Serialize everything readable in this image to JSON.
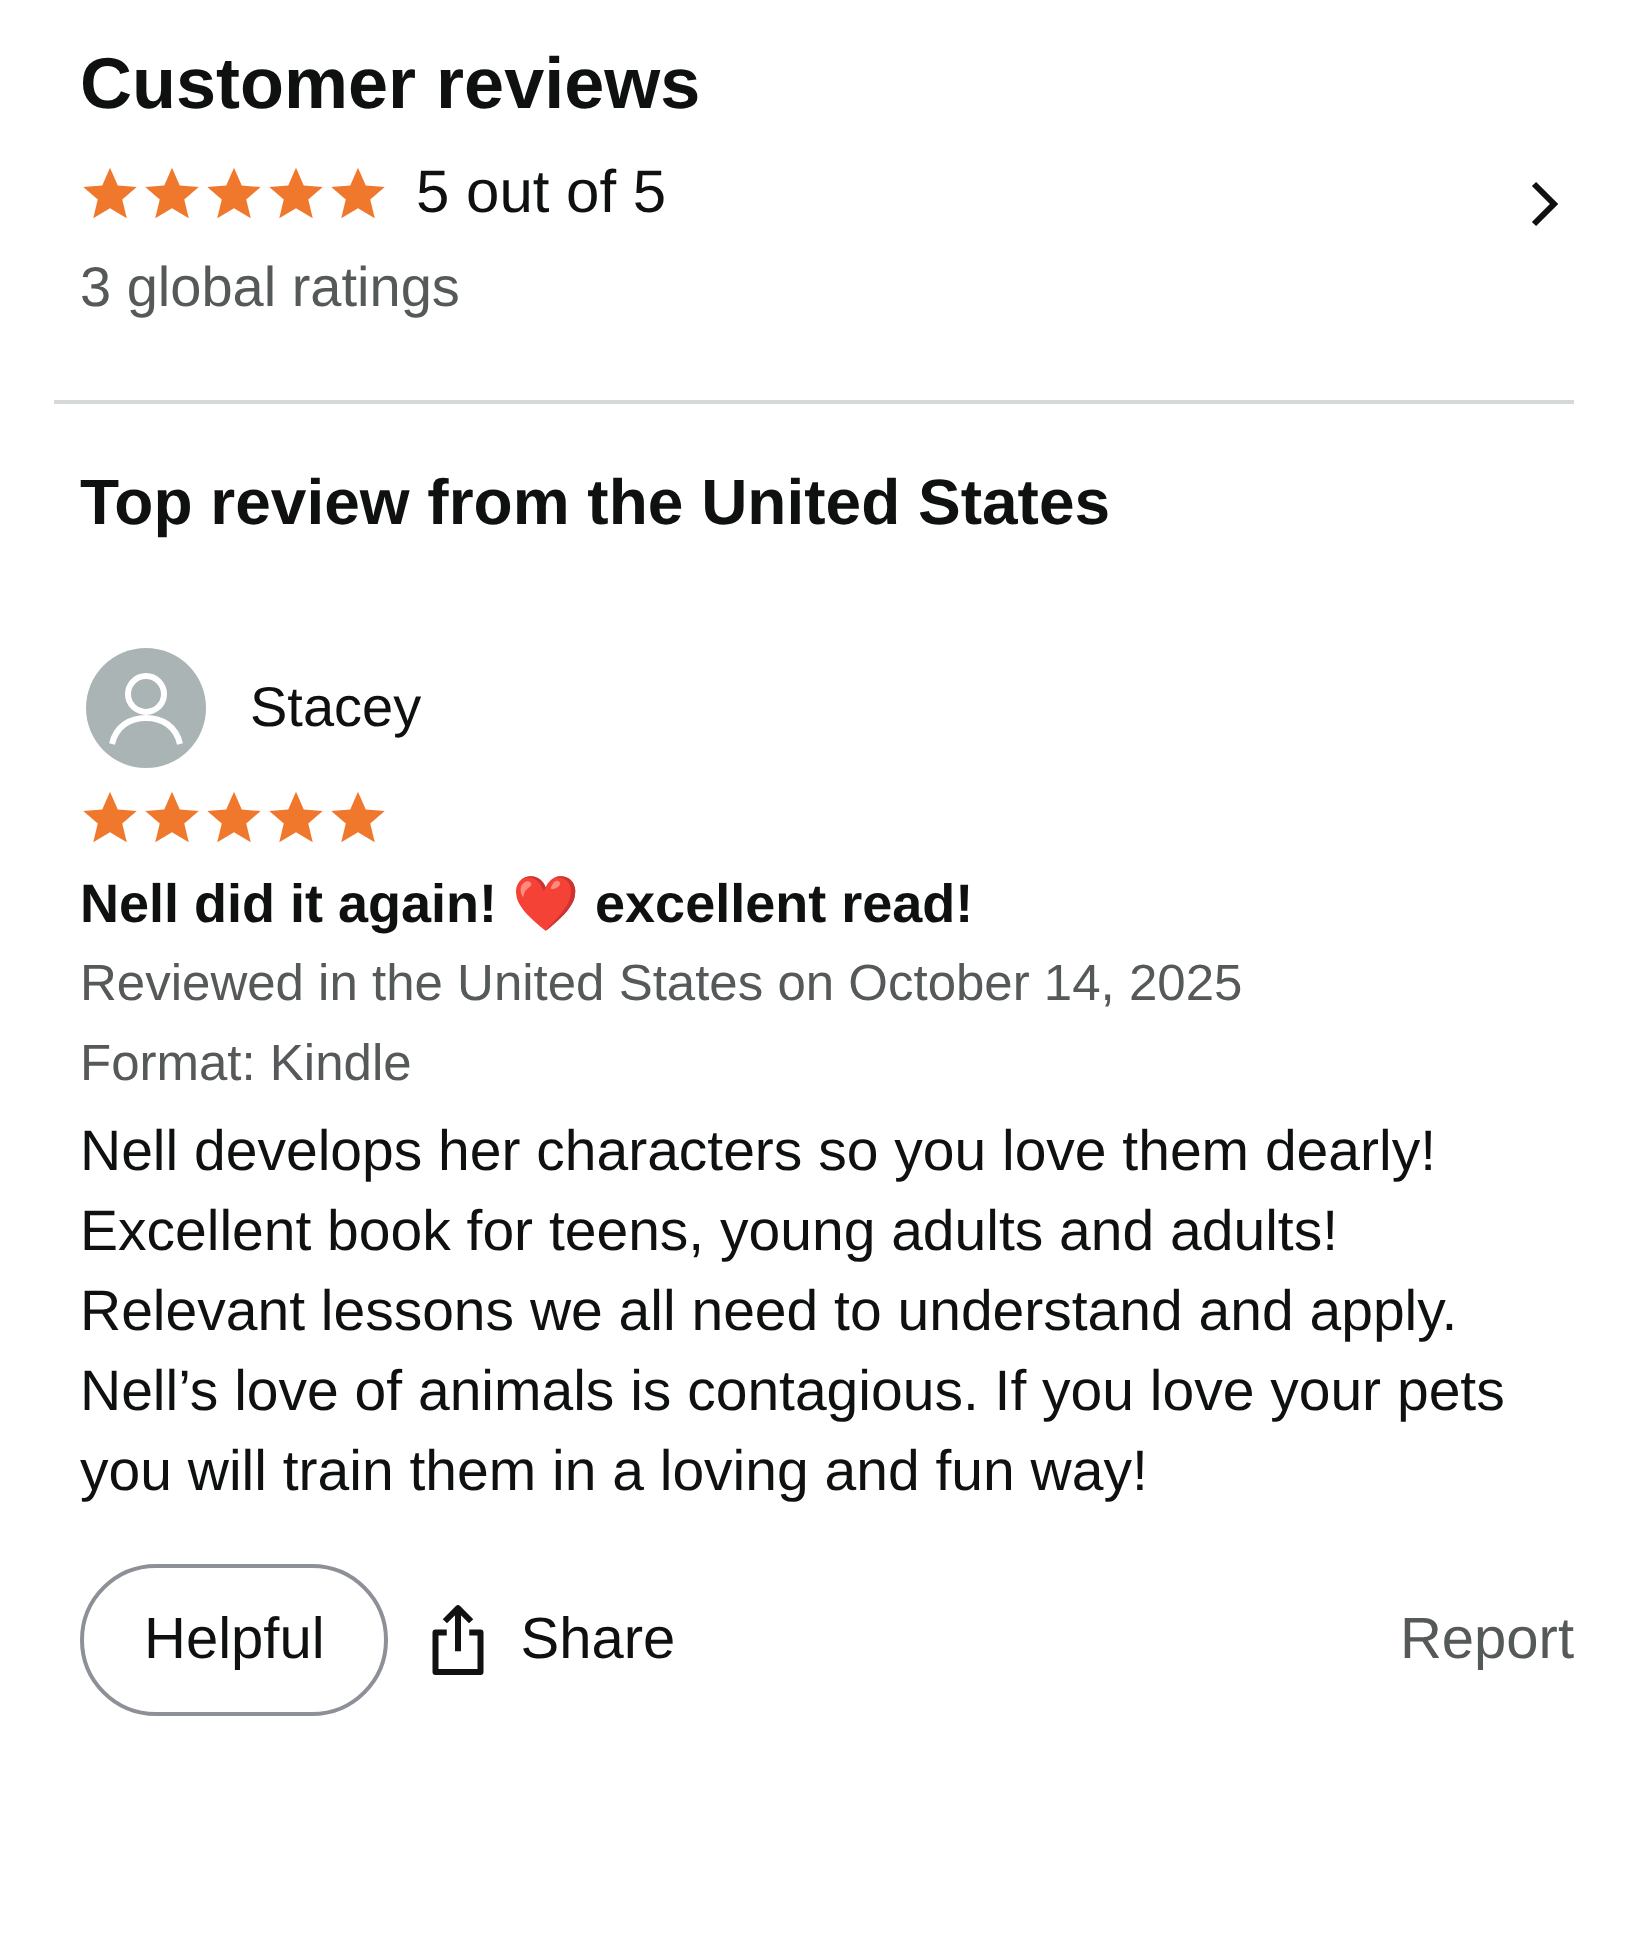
{
  "summary": {
    "title": "Customer reviews",
    "stars": 5,
    "rating_text": "5 out of 5",
    "ratings_count": "3 global ratings"
  },
  "top_review_heading": "Top review from the United States",
  "review": {
    "author": "Stacey",
    "stars": 5,
    "title": "Nell did it again! ❤️ excellent read!",
    "meta": "Reviewed in the United States on October 14, 2025",
    "format": "Format: Kindle",
    "body": "Nell develops her characters so you love them dearly! Excellent book for teens, young adults and adults! Relevant lessons we all need to understand and apply. Nell’s love of animals is contagious. If you love your pets you will train them in a loving and fun way!"
  },
  "actions": {
    "helpful": "Helpful",
    "share": "Share",
    "report": "Report"
  }
}
